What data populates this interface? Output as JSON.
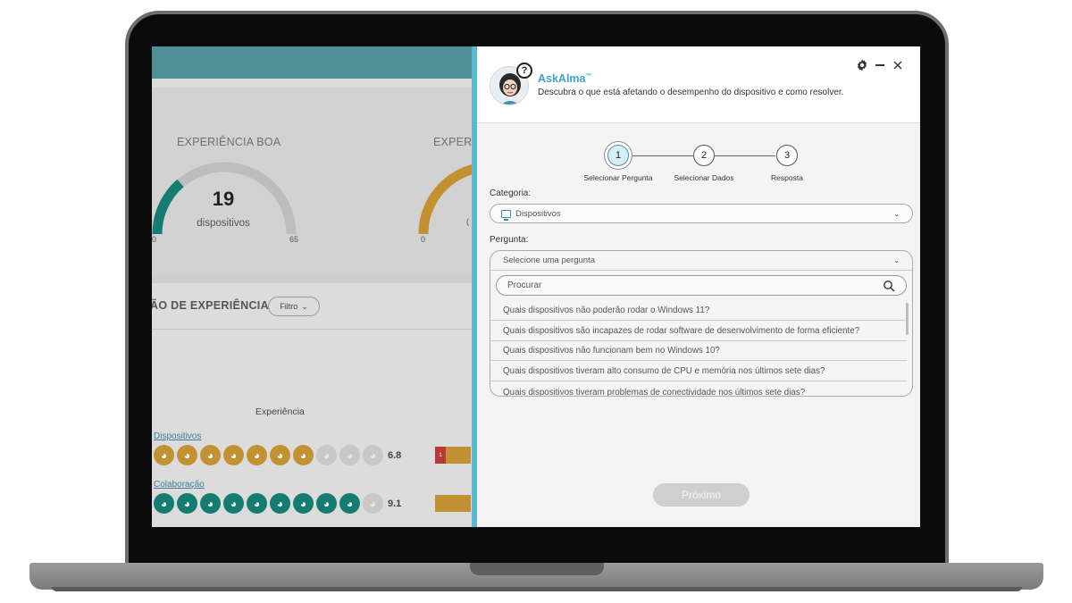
{
  "dashboard": {
    "card_title_left": "EXPERIÊNCIA BOA",
    "card_title_right": "EXPERI",
    "gauge_value": "19",
    "gauge_label": "dispositivos",
    "gauge_min": "0",
    "gauge_max": "65",
    "gauge2_min": "0",
    "gauge2_partial": "(",
    "section_title": "ÃO DE EXPERIÊNCIA",
    "filter_label": "Filtro",
    "experience_heading": "Experiência",
    "rows": [
      {
        "label": "Dispositivos",
        "score": "6.8",
        "badge": "1"
      },
      {
        "label": "Colaboração",
        "score": "9.1"
      }
    ]
  },
  "panel": {
    "app_title": "AskAlma",
    "trademark": "™",
    "subtitle": "Descubra o que está afetando o desempenho do dispositivo e como resolver.",
    "avatar_badge": "?",
    "steps": [
      {
        "number": "1",
        "label": "Selecionar Pergunta"
      },
      {
        "number": "2",
        "label": "Selecionar Dados"
      },
      {
        "number": "3",
        "label": "Resposta"
      }
    ],
    "category_label": "Categoria:",
    "category_value": "Dispositivos",
    "question_label": "Pergunta:",
    "question_placeholder": "Selecione uma pergunta",
    "search_placeholder": "Procurar",
    "questions": [
      "Quais dispositivos não poderão rodar o Windows 11?",
      "Quais dispositivos são incapazes de rodar software de desenvolvimento de forma eficiente?",
      "Quais dispositivos não funcionam bem no Windows 10?",
      "Quais dispositivos tiveram alto consumo de CPU e memória nos últimos sete dias?",
      "Quais dispositivos tiveram problemas de conectividade nos últimos sete dias?"
    ],
    "next_label": "Próximo"
  },
  "colors": {
    "accent": "#3da6c7",
    "gold": "#c29232",
    "teal": "#157c71",
    "dash_header": "#4f8f96"
  }
}
